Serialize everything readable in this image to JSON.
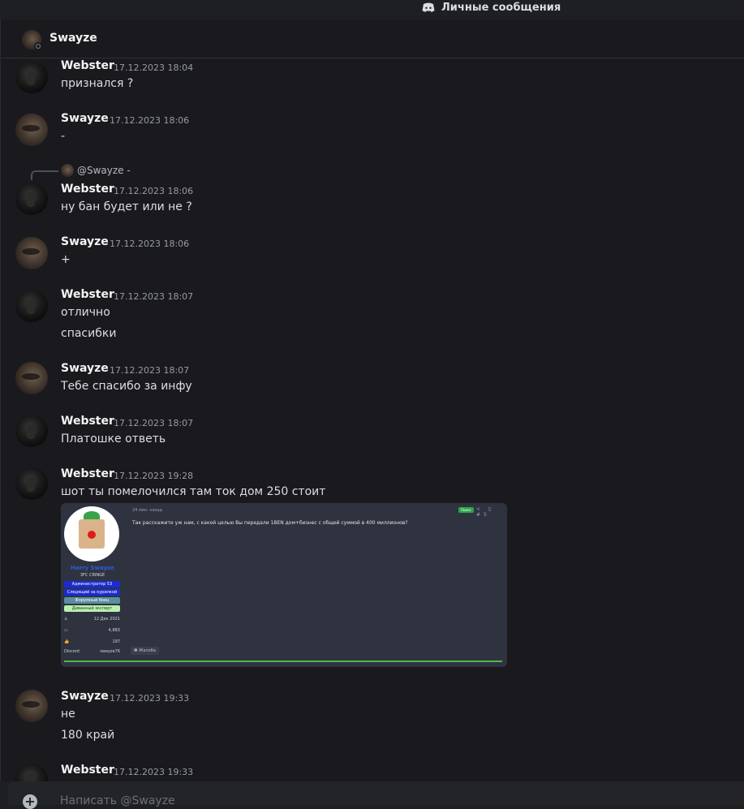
{
  "window": {
    "title": "Личные сообщения"
  },
  "channel": {
    "name": "Swayze"
  },
  "messages": [
    {
      "author": "Webster",
      "time": "17.12.2023 18:04",
      "lines": [
        "признался ?"
      ]
    },
    {
      "author": "Swayze",
      "time": "17.12.2023 18:06",
      "lines": [
        "-"
      ]
    },
    {
      "author": "Webster",
      "time": "17.12.2023 18:06",
      "lines": [
        "ну бан будет или не ?"
      ],
      "reply": {
        "mention": "@Swayze",
        "text": "-"
      }
    },
    {
      "author": "Swayze",
      "time": "17.12.2023 18:06",
      "lines": [
        "+"
      ]
    },
    {
      "author": "Webster",
      "time": "17.12.2023 18:07",
      "lines": [
        "отлично",
        "спасибки"
      ]
    },
    {
      "author": "Swayze",
      "time": "17.12.2023 18:07",
      "lines": [
        "Тебе спасибо за инфу"
      ]
    },
    {
      "author": "Webster",
      "time": "17.12.2023 18:07",
      "lines": [
        "Платошке ответь"
      ]
    },
    {
      "author": "Webster",
      "time": "17.12.2023 19:28",
      "lines": [
        "шот ты помелочился там ток дом 250 стоит"
      ]
    },
    {
      "author": "Swayze",
      "time": "17.12.2023 19:33",
      "lines": [
        "не",
        "180 край"
      ]
    },
    {
      "author": "Webster",
      "time": "17.12.2023 19:33",
      "lines": []
    }
  ],
  "embed": {
    "time": "24 мин. назад",
    "tag": "Поиск",
    "post_id": "#5",
    "post_text": "Так расскажите уж нам, с какой целью Вы передали 1BEN дом+бизнес с общей суммой в 400 миллионов?",
    "user": "Harry Swayze",
    "user_sub": "3FC CRINGE",
    "badges": [
      "Администратор 53",
      "Следящий за курилкой",
      "Форумный боец",
      "Диванный эксперт"
    ],
    "stats": [
      {
        "k": "♙",
        "v": "12 Дек 2021"
      },
      {
        "k": "▭",
        "v": "4,883"
      },
      {
        "k": "👍",
        "v": "197"
      },
      {
        "k": "Discord",
        "v": "swayze76"
      }
    ],
    "report": "❶ Жалоба"
  },
  "composer": {
    "placeholder": "Написать @Swayze"
  }
}
